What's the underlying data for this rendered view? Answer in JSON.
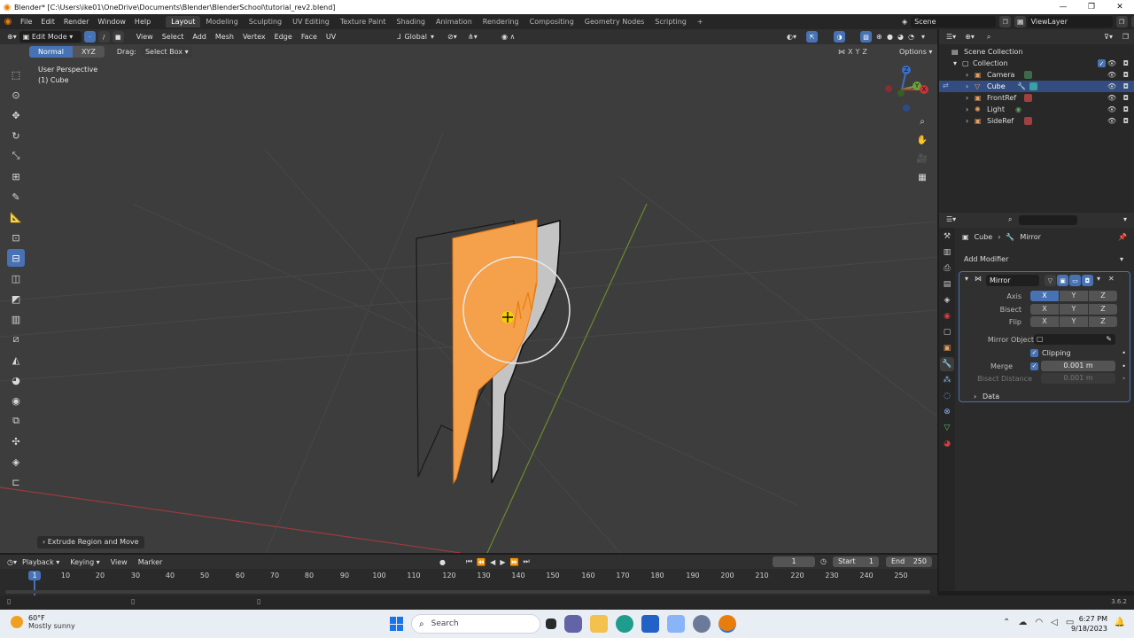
{
  "window": {
    "title": "Blender* [C:\\Users\\ike01\\OneDrive\\Documents\\Blender\\BlenderSchool\\tutorial_rev2.blend]",
    "minimize": "—",
    "maximize": "❐",
    "close": "✕"
  },
  "topbar": {
    "menu": [
      "File",
      "Edit",
      "Render",
      "Window",
      "Help"
    ],
    "workspaces": [
      "Layout",
      "Modeling",
      "Sculpting",
      "UV Editing",
      "Texture Paint",
      "Shading",
      "Animation",
      "Rendering",
      "Compositing",
      "Geometry Nodes",
      "Scripting"
    ],
    "active_workspace": "Layout",
    "add_tab": "+",
    "scene": "Scene",
    "view_layer": "ViewLayer"
  },
  "viewport": {
    "mode": "Edit Mode",
    "menu": [
      "View",
      "Select",
      "Add",
      "Mesh",
      "Vertex",
      "Edge",
      "Face",
      "UV"
    ],
    "transform_orientation": "Global",
    "options_label": "Options",
    "drag_label": "Drag:",
    "drag_mode": "Select Box",
    "orient_normal": "Normal",
    "orient_xyz": "XYZ",
    "axis_lock": [
      "X",
      "Y",
      "Z"
    ],
    "perspective_label": "User Perspective",
    "object_label": "(1) Cube",
    "last_operator": "Extrude Region and Move",
    "gizmo_axes": [
      "Z",
      "Y",
      "X"
    ]
  },
  "outliner": {
    "root": "Scene Collection",
    "collection": "Collection",
    "items": [
      {
        "name": "Camera",
        "selected": false
      },
      {
        "name": "Cube",
        "selected": true
      },
      {
        "name": "FrontRef",
        "selected": false
      },
      {
        "name": "Light",
        "selected": false
      },
      {
        "name": "SideRef",
        "selected": false
      }
    ]
  },
  "properties": {
    "object": "Cube",
    "modifier_crumb": "Mirror",
    "add_modifier": "Add Modifier",
    "modifier": {
      "name": "Mirror",
      "axis_label": "Axis",
      "bisect_label": "Bisect",
      "flip_label": "Flip",
      "axes": [
        "X",
        "Y",
        "Z"
      ],
      "axis_active": "X",
      "mirror_object_label": "Mirror Object",
      "clipping_label": "Clipping",
      "clipping": true,
      "merge_label": "Merge",
      "merge": true,
      "merge_value": "0.001 m",
      "bisect_distance_label": "Bisect Distance",
      "bisect_distance_value": "0.001 m",
      "data_label": "Data"
    }
  },
  "timeline": {
    "menu": [
      "Playback",
      "Keying",
      "View",
      "Marker"
    ],
    "current_frame": "1",
    "start_label": "Start",
    "start": "1",
    "end_label": "End",
    "end": "250",
    "ruler": [
      "10",
      "20",
      "30",
      "40",
      "50",
      "60",
      "70",
      "80",
      "90",
      "100",
      "110",
      "120",
      "130",
      "140",
      "150",
      "160",
      "170",
      "180",
      "190",
      "200",
      "210",
      "220",
      "230",
      "240",
      "250"
    ],
    "playhead_label": "1"
  },
  "status": {
    "version": "3.6.2"
  },
  "taskbar": {
    "temperature": "60°F",
    "weather": "Mostly sunny",
    "search_placeholder": "Search",
    "time": "6:27 PM",
    "date": "9/18/2023"
  },
  "colors": {
    "accent": "#4772b3",
    "selected_face": "#f5a04a",
    "blender_orange": "#e87d0d"
  }
}
